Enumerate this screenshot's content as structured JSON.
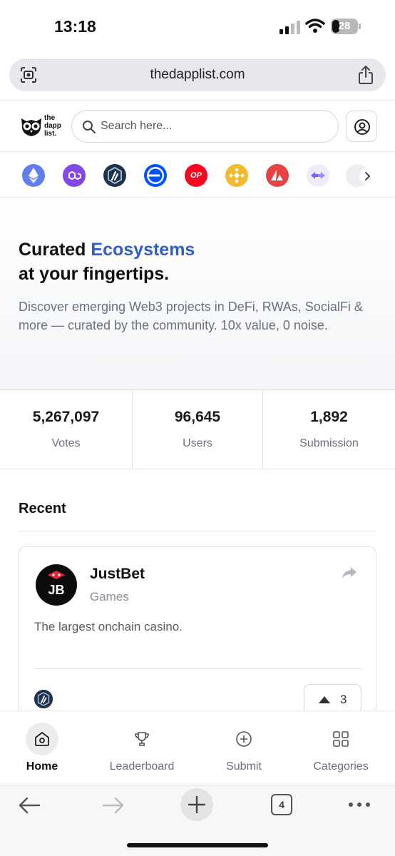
{
  "status_bar": {
    "time": "13:18",
    "battery": "28"
  },
  "browser": {
    "url": "thedapplist.com",
    "tab_count": "4"
  },
  "site": {
    "brand_lines": [
      "the",
      "dapp",
      "list."
    ],
    "search_placeholder": "Search here..."
  },
  "chains": [
    {
      "name": "ethereum-icon",
      "color": "#627eea"
    },
    {
      "name": "polygon-icon",
      "color": "#8247e5"
    },
    {
      "name": "arbitrum-icon",
      "color": "#213147"
    },
    {
      "name": "base-icon",
      "color": "#0052ff"
    },
    {
      "name": "optimism-icon",
      "color": "#ff0420",
      "label": "OP"
    },
    {
      "name": "bnb-icon",
      "color": "#f3ba2f"
    },
    {
      "name": "avalanche-icon",
      "color": "#e84142"
    },
    {
      "name": "bridge-icon",
      "color": "#7b61ff"
    },
    {
      "name": "partial-chain-icon",
      "color": "#d9dbe0"
    }
  ],
  "hero": {
    "title_start": "Curated ",
    "title_accent": "Ecosystems",
    "title_line2": "at your fingertips.",
    "description": "Discover emerging Web3 projects in DeFi, RWAs, SocialFi & more — curated by the community. 10x value, 0 noise."
  },
  "stats": [
    {
      "value": "5,267,097",
      "label": "Votes"
    },
    {
      "value": "96,645",
      "label": "Users"
    },
    {
      "value": "1,892",
      "label": "Submission"
    }
  ],
  "recent": {
    "title": "Recent",
    "items": [
      {
        "name": "JustBet",
        "category": "Games",
        "description": "The largest onchain casino.",
        "votes": "3",
        "logo_text": "JB"
      }
    ]
  },
  "bottom_nav": [
    {
      "label": "Home",
      "icon": "home-icon",
      "active": true
    },
    {
      "label": "Leaderboard",
      "icon": "trophy-icon",
      "active": false
    },
    {
      "label": "Submit",
      "icon": "plus-circle-icon",
      "active": false
    },
    {
      "label": "Categories",
      "icon": "grid-icon",
      "active": false
    }
  ]
}
